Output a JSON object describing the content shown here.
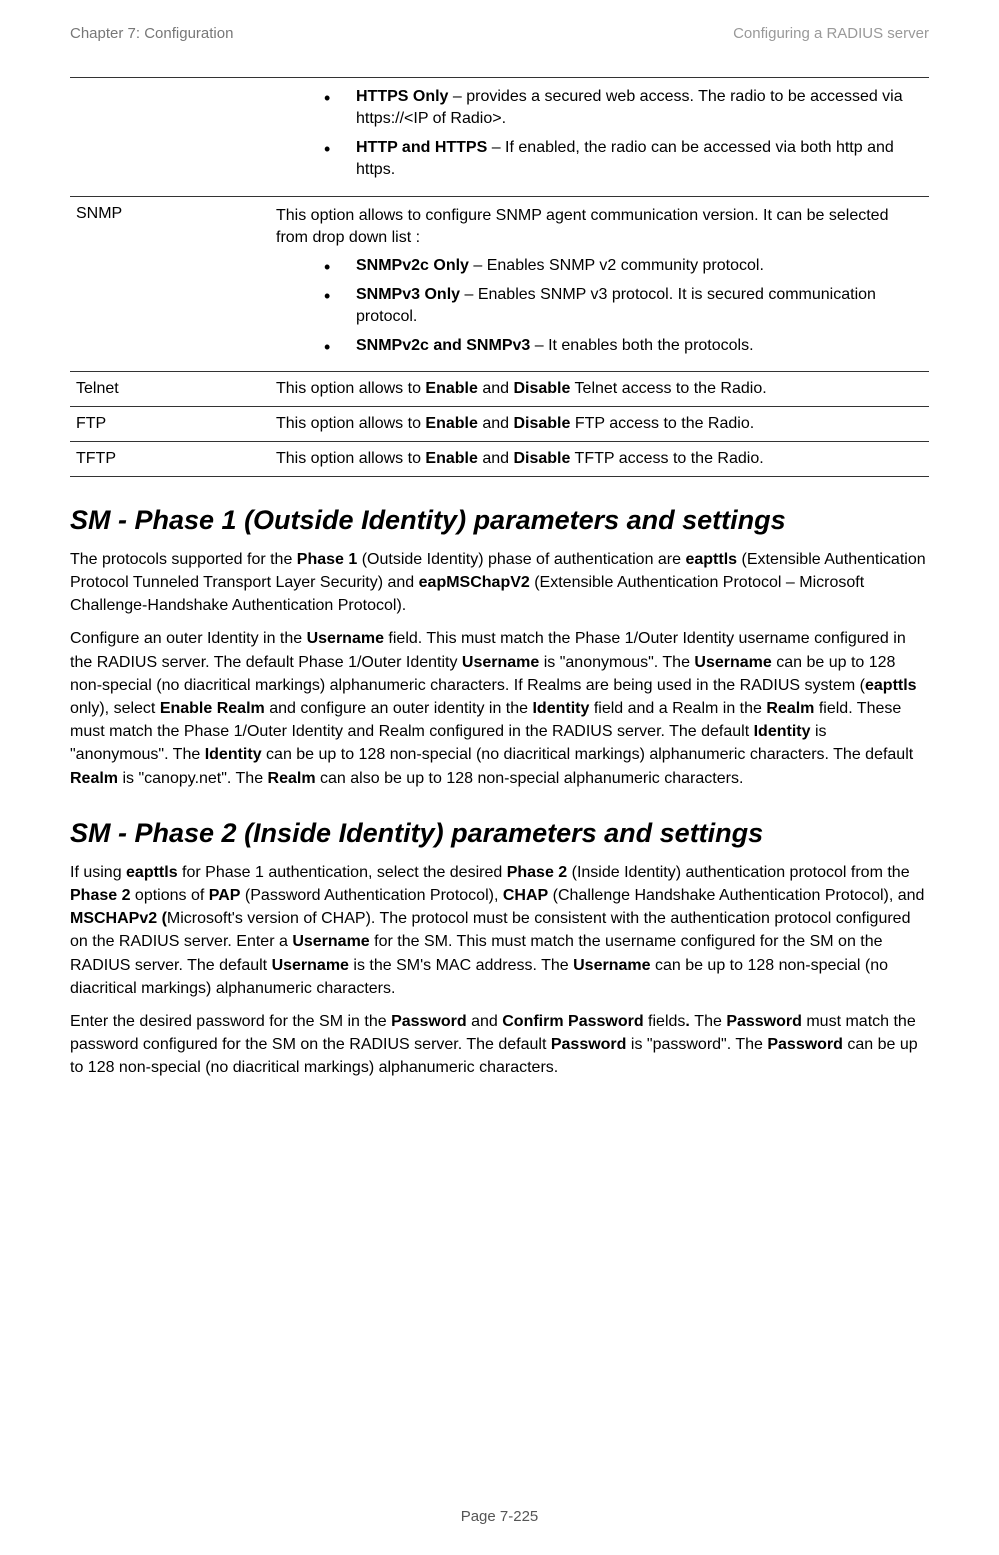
{
  "header": {
    "left": "Chapter 7:  Configuration",
    "right": "Configuring a RADIUS server"
  },
  "t": {
    "r0_b1_lead": "HTTPS Only",
    "r0_b1_rest": " – provides a secured web access. The radio to be accessed via https://<IP of Radio>.",
    "r0_b2_lead": "HTTP and HTTPS",
    "r0_b2_rest": " – If enabled, the radio can be accessed via both http and https.",
    "r1_label": "SNMP",
    "r1_desc": "This option allows to configure SNMP agent communication version. It can be selected from drop down list :",
    "r1_b1_lead": "SNMPv2c Only",
    "r1_b1_rest": " – Enables SNMP v2 community protocol.",
    "r1_b2_lead": "SNMPv3 Only",
    "r1_b2_rest": " – Enables SNMP v3 protocol. It is secured communication protocol.",
    "r1_b3_lead": "SNMPv2c and SNMPv3",
    "r1_b3_rest": " – It enables both the protocols.",
    "r2_label": "Telnet",
    "r2_desc_a": "This option allows to ",
    "r2_desc_b": "Enable",
    "r2_desc_c": " and ",
    "r2_desc_d": "Disable",
    "r2_desc_e": " Telnet access to the Radio.",
    "r3_label": "FTP",
    "r3_desc_a": "This option allows to ",
    "r3_desc_b": "Enable",
    "r3_desc_c": " and ",
    "r3_desc_d": "Disable",
    "r3_desc_e": " FTP access to the Radio.",
    "r4_label": "TFTP",
    "r4_desc_a": "This option allows to ",
    "r4_desc_b": "Enable",
    "r4_desc_c": " and ",
    "r4_desc_d": "Disable",
    "r4_desc_e": " TFTP access to the Radio."
  },
  "s1": {
    "title": "SM - Phase 1 (Outside Identity) parameters and settings",
    "p1_a": "The protocols supported for the ",
    "p1_b": "Phase 1",
    "p1_c": " (Outside Identity) phase of authentication are ",
    "p1_d": "eapttls",
    "p1_e": " (Extensible Authentication Protocol Tunneled Transport Layer Security) and ",
    "p1_f": "eapMSChapV2",
    "p1_g": " (Extensible Authentication Protocol – Microsoft Challenge-Handshake Authentication Protocol).",
    "p2_a": "Configure an outer Identity in the ",
    "p2_b": "Username",
    "p2_c": " field. This must match the Phase 1/Outer Identity username configured in the RADIUS server. The default Phase 1/Outer Identity ",
    "p2_d": "Username",
    "p2_e": " is \"anonymous\". The ",
    "p2_f": "Username",
    "p2_g": " can be up to 128 non-special (no diacritical markings) alphanumeric characters. If Realms are being used in the RADIUS system (",
    "p2_h": "eapttls",
    "p2_i": " only), select ",
    "p2_j": "Enable Realm",
    "p2_k": " and configure an outer identity in the ",
    "p2_l": "Identity",
    "p2_m": " field and a Realm in the ",
    "p2_n": "Realm",
    "p2_o": " field. These must match the Phase 1/Outer Identity and Realm configured in the RADIUS server. The default ",
    "p2_p": "Identity",
    "p2_q": " is \"anonymous\". The ",
    "p2_r": "Identity",
    "p2_s": " can be up to 128 non-special (no diacritical markings) alphanumeric characters. The default ",
    "p2_t": "Realm",
    "p2_u": " is \"canopy.net\". The ",
    "p2_v": "Realm",
    "p2_w": " can also be up to 128 non-special alphanumeric characters."
  },
  "s2": {
    "title": "SM - Phase 2 (Inside Identity) parameters and settings",
    "p1_a": "If using ",
    "p1_b": "eapttls",
    "p1_c": " for Phase 1 authentication, select the desired ",
    "p1_d": "Phase 2",
    "p1_e": " (Inside Identity) authentication protocol from the ",
    "p1_f": "Phase 2",
    "p1_g": " options of ",
    "p1_h": "PAP",
    "p1_i": " (Password Authentication Protocol), ",
    "p1_j": "CHAP",
    "p1_k": " (Challenge Handshake Authentication Protocol), and ",
    "p1_l": "MSCHAPv2 (",
    "p1_m": "Microsoft's version of CHAP). The protocol must be consistent with the authentication protocol configured on the RADIUS server. Enter a ",
    "p1_n": "Username",
    "p1_o": " for the SM. This must match the username configured for the SM on the RADIUS server. The default ",
    "p1_p": "Username",
    "p1_q": " is the SM's MAC address. The ",
    "p1_r": "Username",
    "p1_s": " can be up to 128 non-special (no diacritical markings) alphanumeric characters.",
    "p2_a": "Enter the desired password for the SM in the ",
    "p2_b": "Password",
    "p2_c": " and ",
    "p2_d": "Confirm Password",
    "p2_e": " fields",
    "p2_f": ". ",
    "p2_g": "The ",
    "p2_h": "Password",
    "p2_i": " must match the password configured for the SM on the RADIUS server. The default ",
    "p2_j": "Password",
    "p2_k": " is \"password\". The ",
    "p2_l": "Password",
    "p2_m": " can be up to 128 non-special (no diacritical markings) alphanumeric characters."
  },
  "footer": "Page 7-225"
}
